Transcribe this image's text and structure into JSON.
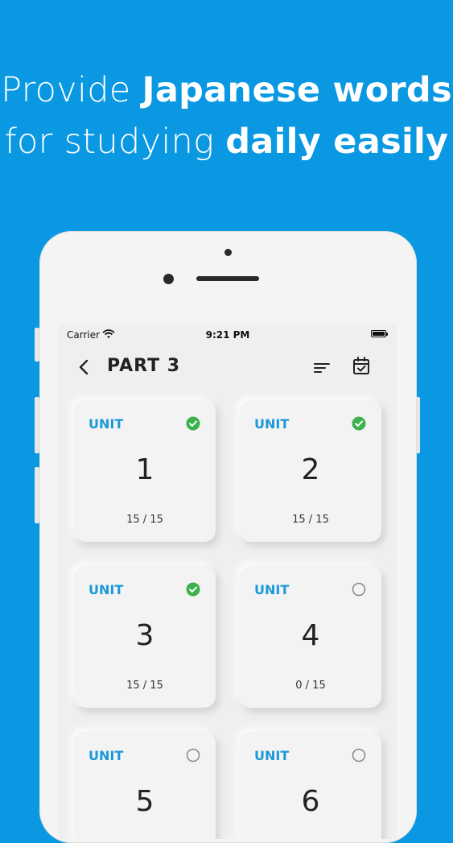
{
  "headline": {
    "line1_light": "Provide ",
    "line1_bold": "Japanese words",
    "line2_light": "for studying ",
    "line2_bold": "daily easily"
  },
  "status_bar": {
    "carrier": "Carrier",
    "time": "9:21 PM"
  },
  "nav": {
    "title": "PART 3",
    "back_icon": "chevron-left-icon",
    "sort_icon": "sort-icon",
    "calendar_icon": "calendar-check-icon"
  },
  "colors": {
    "background": "#0a98e2",
    "accent": "#1a98d8",
    "done": "#3db14e",
    "pending": "#888888"
  },
  "units": [
    {
      "label": "UNIT",
      "number": "1",
      "progress": "15 / 15",
      "completed": true
    },
    {
      "label": "UNIT",
      "number": "2",
      "progress": "15 / 15",
      "completed": true
    },
    {
      "label": "UNIT",
      "number": "3",
      "progress": "15 / 15",
      "completed": true
    },
    {
      "label": "UNIT",
      "number": "4",
      "progress": "0 / 15",
      "completed": false
    },
    {
      "label": "UNIT",
      "number": "5",
      "progress": "",
      "completed": false
    },
    {
      "label": "UNIT",
      "number": "6",
      "progress": "",
      "completed": false
    }
  ]
}
